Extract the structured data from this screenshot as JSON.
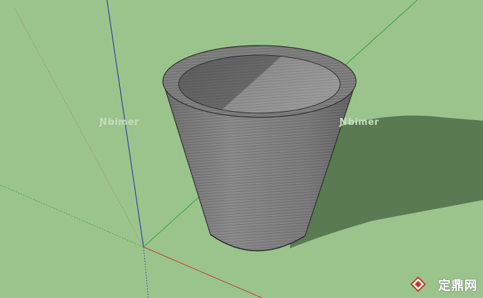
{
  "watermarks": {
    "left_text": "bimer",
    "right_text": "bimer",
    "brand_text": "定鼎网",
    "icon": "n-logo-icon"
  },
  "scene": {
    "background": "#9bc48d",
    "object": "flower-pot",
    "axes": {
      "blue": "#2f3fa0",
      "green": "#2fa23f",
      "red": "#b8402b"
    }
  }
}
